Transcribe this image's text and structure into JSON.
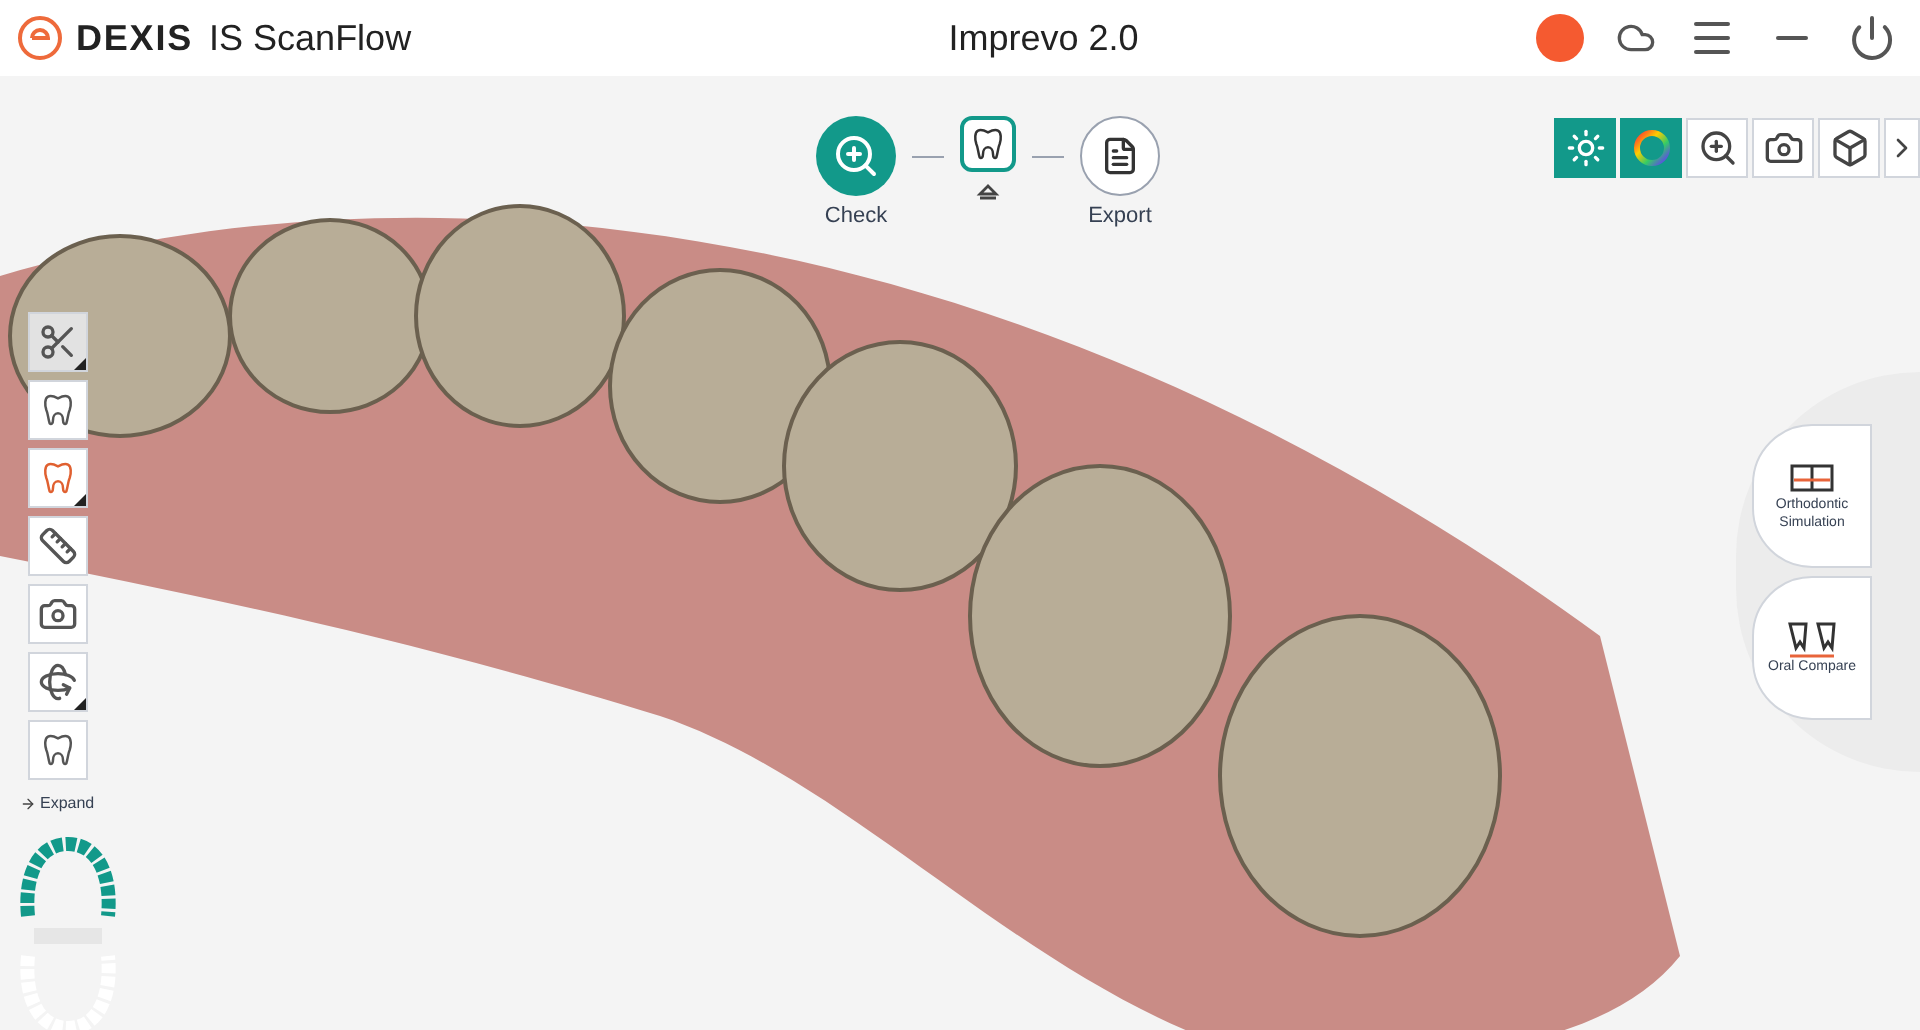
{
  "window": {
    "brand": "DEXIS",
    "product": "IS ScanFlow",
    "title": "Imprevo 2.0"
  },
  "workflow": {
    "steps": [
      {
        "kind": "check",
        "label": "Check",
        "selected": true,
        "completed": false
      },
      {
        "kind": "scan",
        "selected": false,
        "completed": true
      },
      {
        "kind": "export",
        "label": "Export",
        "selected": false,
        "completed": false
      }
    ]
  },
  "view_tools": [
    {
      "kind": "light",
      "on": true
    },
    {
      "kind": "color",
      "on": true
    },
    {
      "kind": "zoom",
      "on": false
    },
    {
      "kind": "snapshot",
      "on": false
    },
    {
      "kind": "cube",
      "on": false
    },
    {
      "kind": "more",
      "on": false
    }
  ],
  "left_tools": [
    {
      "kind": "trim",
      "selected": true,
      "submenu": true
    },
    {
      "kind": "report",
      "selected": false,
      "submenu": false
    },
    {
      "kind": "tooth-alert",
      "selected": false,
      "submenu": true
    },
    {
      "kind": "gauge",
      "selected": false,
      "submenu": false
    },
    {
      "kind": "photo",
      "selected": false,
      "submenu": false
    },
    {
      "kind": "rotate",
      "selected": false,
      "submenu": true
    },
    {
      "kind": "bite",
      "selected": false,
      "submenu": false
    }
  ],
  "expand_label": "Expand",
  "radial_menu": [
    {
      "kind": "ortho",
      "label": "Orthodontic Simulation"
    },
    {
      "kind": "compare",
      "label": "Oral Compare"
    }
  ],
  "jaw_map": {
    "upper_selected": true,
    "lower_selected": false
  }
}
